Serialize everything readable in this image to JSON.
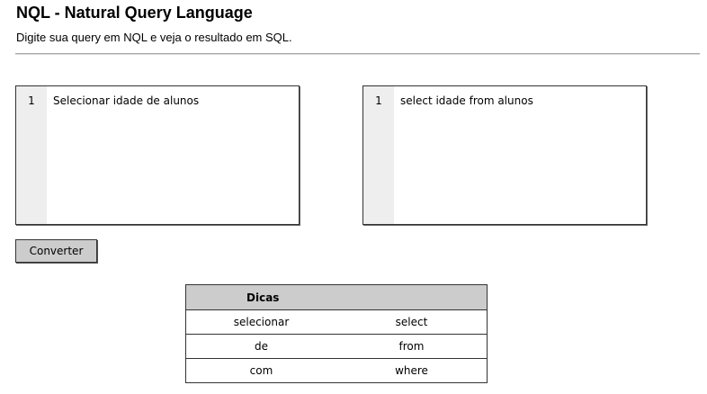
{
  "header": {
    "title": "NQL - Natural Query Language",
    "subtitle": "Digite sua query em NQL e veja o resultado em SQL."
  },
  "editors": {
    "nql": {
      "line_number": "1",
      "content": "Selecionar idade de alunos"
    },
    "sql": {
      "line_number": "1",
      "content": "select idade from alunos"
    }
  },
  "actions": {
    "convert_label": "Converter"
  },
  "tips": {
    "header": "Dicas",
    "rows": [
      {
        "nql": "selecionar",
        "sql": "select"
      },
      {
        "nql": "de",
        "sql": "from"
      },
      {
        "nql": "com",
        "sql": "where"
      }
    ]
  }
}
